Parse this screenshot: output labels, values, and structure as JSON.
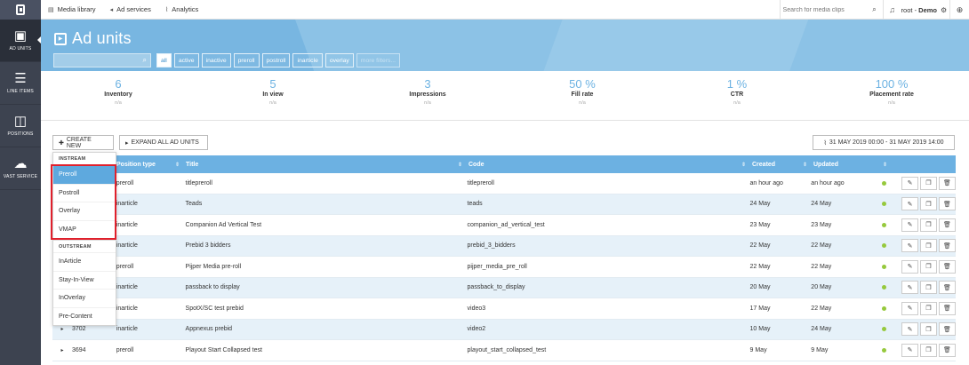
{
  "sidebar": {
    "items": [
      {
        "label": "AD UNITS",
        "icon": "play-square-icon",
        "glyph": "▣"
      },
      {
        "label": "LINE ITEMS",
        "icon": "list-icon",
        "glyph": "☰"
      },
      {
        "label": "POSITIONS",
        "icon": "columns-icon",
        "glyph": "◫"
      },
      {
        "label": "VAST SERVICE",
        "icon": "cloud-upload-icon",
        "glyph": "☁"
      }
    ]
  },
  "topbar": {
    "tabs": [
      {
        "label": "Media library",
        "icon": "book-icon",
        "glyph": "▤"
      },
      {
        "label": "Ad services",
        "icon": "megaphone-icon",
        "glyph": "◂"
      },
      {
        "label": "Analytics",
        "icon": "chart-icon",
        "glyph": "⌇"
      }
    ],
    "search_placeholder": "Search for media clips",
    "user_name": "root",
    "user_org": "Demo"
  },
  "header": {
    "title": "Ad units",
    "filters": [
      "all",
      "active",
      "inactive",
      "preroll",
      "postroll",
      "inarticle",
      "overlay"
    ],
    "more_filters": "more filters..."
  },
  "stats": [
    {
      "value": "6",
      "label": "Inventory",
      "sub": "n/a"
    },
    {
      "value": "5",
      "label": "In view",
      "sub": "n/a"
    },
    {
      "value": "3",
      "label": "Impressions",
      "sub": "n/a"
    },
    {
      "value": "50 %",
      "label": "Fill rate",
      "sub": "n/a"
    },
    {
      "value": "1 %",
      "label": "CTR",
      "sub": "n/a"
    },
    {
      "value": "100 %",
      "label": "Placement rate",
      "sub": "n/a"
    }
  ],
  "toolbar": {
    "create_label": "CREATE NEW",
    "expand_label": "EXPAND ALL AD UNITS",
    "date_range": "31 MAY 2019 00:00 - 31 MAY 2019 14:00"
  },
  "table": {
    "headers": {
      "position_type": "Position type",
      "title": "Title",
      "code": "Code",
      "created": "Created",
      "updated": "Updated"
    },
    "rows": [
      {
        "id": "",
        "position": "preroll",
        "title": "titlepreroll",
        "code": "titlepreroll",
        "created": "an hour ago",
        "updated": "an hour ago"
      },
      {
        "id": "",
        "position": "inarticle",
        "title": "Teads",
        "code": "teads",
        "created": "24 May",
        "updated": "24 May"
      },
      {
        "id": "",
        "position": "inarticle",
        "title": "Companion Ad Vertical Test",
        "code": "companion_ad_vertical_test",
        "created": "23 May",
        "updated": "23 May"
      },
      {
        "id": "",
        "position": "inarticle",
        "title": "Prebid 3 bidders",
        "code": "prebid_3_bidders",
        "created": "22 May",
        "updated": "22 May"
      },
      {
        "id": "",
        "position": "preroll",
        "title": "Pijper Media pre-roll",
        "code": "pijper_media_pre_roll",
        "created": "22 May",
        "updated": "22 May"
      },
      {
        "id": "",
        "position": "inarticle",
        "title": "passback to display",
        "code": "passback_to_display",
        "created": "20 May",
        "updated": "20 May"
      },
      {
        "id": "",
        "position": "inarticle",
        "title": "SpotX/SC test prebid",
        "code": "video3",
        "created": "17 May",
        "updated": "22 May"
      },
      {
        "id": "3702",
        "position": "inarticle",
        "title": "Appnexus prebid",
        "code": "video2",
        "created": "10 May",
        "updated": "24 May"
      },
      {
        "id": "3694",
        "position": "preroll",
        "title": "Playout Start Collapsed test",
        "code": "playout_start_collapsed_test",
        "created": "9 May",
        "updated": "9 May"
      }
    ]
  },
  "dropdown": {
    "instream_label": "INSTREAM",
    "instream_items": [
      "Preroll",
      "Postroll",
      "Overlay",
      "VMAP"
    ],
    "outstream_label": "OUTSTREAM",
    "outstream_items": [
      "InArticle",
      "Stay-In-View",
      "InOverlay",
      "Pre-Content"
    ]
  },
  "colors": {
    "accent": "#6cb1e2",
    "sidebar": "#3d4350",
    "highlight": "#e0202c",
    "status_active": "#96c93d"
  }
}
